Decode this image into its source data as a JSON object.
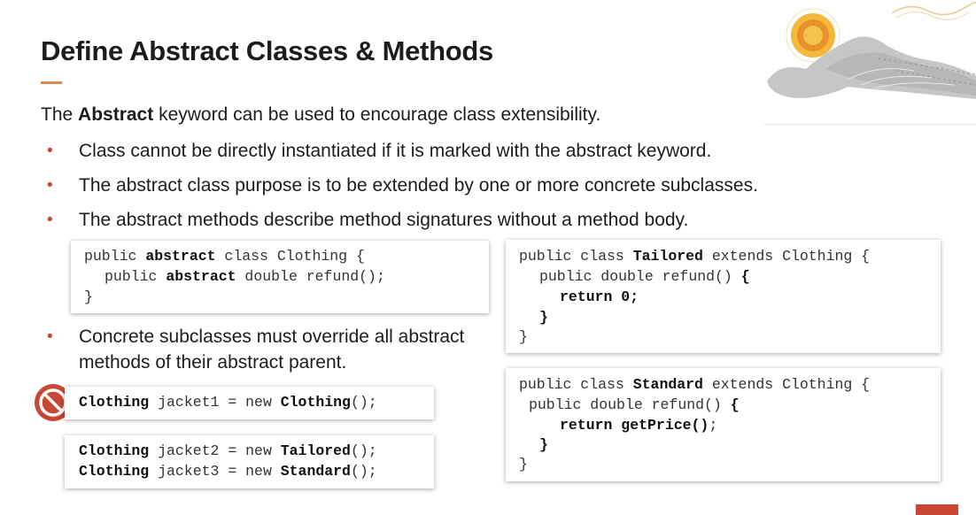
{
  "slide": {
    "title": "Define Abstract Classes & Methods",
    "intro": {
      "prefix": "The ",
      "bold": "Abstract",
      "suffix": " keyword can be used to encourage class extensibility."
    },
    "bullets": [
      "Class cannot be directly instantiated if it is marked with the abstract keyword.",
      "The abstract class purpose is to be extended by one or more concrete subclasses.",
      "The abstract methods describe method signatures without a method body.",
      "Concrete subclasses must override all abstract methods of their abstract parent."
    ],
    "bullet_marker": "•",
    "colors": {
      "accent": "#d98a4c",
      "bullet": "#c74634",
      "forbidden": "#c74634"
    }
  },
  "code": {
    "clothing_class": {
      "l1": [
        "public ",
        "abstract",
        " class Clothing {"
      ],
      "l2": [
        "public ",
        "abstract",
        " double refund();"
      ],
      "l3": "}"
    },
    "tailored_class": {
      "l1": [
        "public class ",
        "Tailored",
        " extends Clothing {"
      ],
      "l2": [
        "public double refund() ",
        "{"
      ],
      "l3": "return 0;",
      "l4": "}",
      "l5": "}"
    },
    "standard_class": {
      "l1": [
        "public class ",
        "Standard",
        " extends Clothing {"
      ],
      "l2": [
        "public double refund() ",
        "{"
      ],
      "l3": [
        "return getPrice()",
        ";"
      ],
      "l4": "}",
      "l5": "}"
    },
    "invalid_instantiation": [
      "Clothing",
      " jacket1 = new ",
      "Clothing",
      "();"
    ],
    "valid_instantiation_1": [
      "Clothing",
      " jacket2 = new ",
      "Tailored",
      "();"
    ],
    "valid_instantiation_2": [
      "Clothing",
      " jacket3 = new ",
      "Standard",
      "();"
    ]
  },
  "icons": {
    "forbidden": "prohibited-icon",
    "decoration": "sun-mountain-illustration"
  }
}
